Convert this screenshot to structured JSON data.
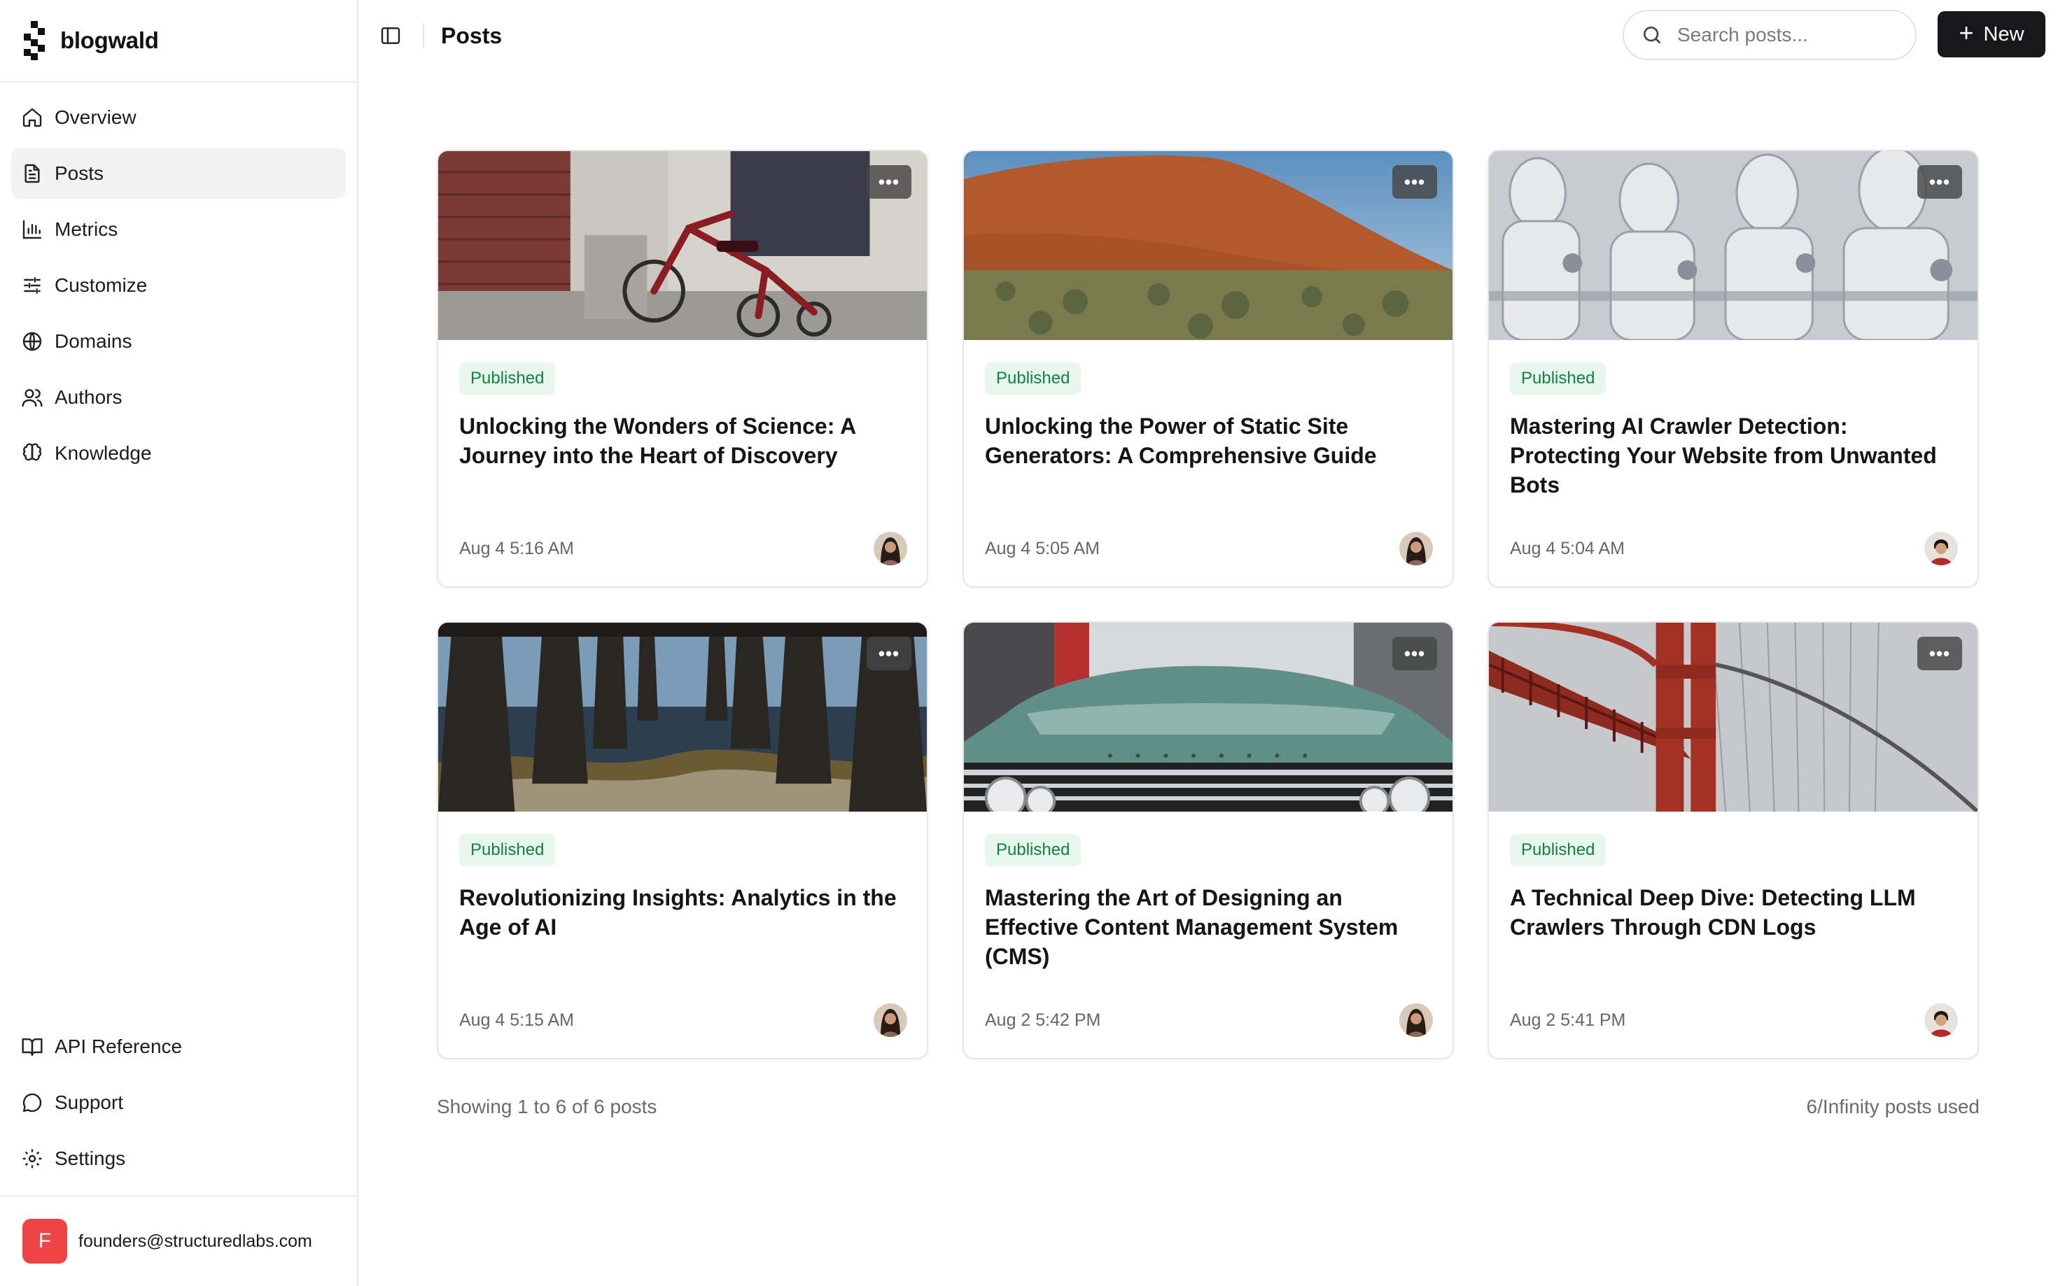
{
  "brand": {
    "name": "blogwald"
  },
  "nav": {
    "items": [
      {
        "label": "Overview",
        "icon": "home-icon"
      },
      {
        "label": "Posts",
        "icon": "document-icon"
      },
      {
        "label": "Metrics",
        "icon": "bar-chart-icon"
      },
      {
        "label": "Customize",
        "icon": "sliders-icon"
      },
      {
        "label": "Domains",
        "icon": "globe-icon"
      },
      {
        "label": "Authors",
        "icon": "users-icon"
      },
      {
        "label": "Knowledge",
        "icon": "brain-icon"
      }
    ],
    "bottom": [
      {
        "label": "API Reference",
        "icon": "book-icon"
      },
      {
        "label": "Support",
        "icon": "chat-bubble-icon"
      },
      {
        "label": "Settings",
        "icon": "gear-icon"
      }
    ]
  },
  "account": {
    "initial": "F",
    "email": "founders@structuredlabs.com"
  },
  "header": {
    "title": "Posts",
    "search_placeholder": "Search posts...",
    "new_label": "New"
  },
  "posts": [
    {
      "status": "Published",
      "title": "Unlocking the Wonders of Science: A Journey into the Heart of Discovery",
      "date": "Aug 4 5:16 AM",
      "image": "tricycle",
      "avatar": "woman"
    },
    {
      "status": "Published",
      "title": "Unlocking the Power of Static Site Generators: A Comprehensive Guide",
      "date": "Aug 4 5:05 AM",
      "image": "desert-rock",
      "avatar": "woman"
    },
    {
      "status": "Published",
      "title": "Mastering AI Crawler Detection: Protecting Your Website from Unwanted Bots",
      "date": "Aug 4 5:04 AM",
      "image": "robots",
      "avatar": "man"
    },
    {
      "status": "Published",
      "title": "Revolutionizing Insights: Analytics in the Age of AI",
      "date": "Aug 4 5:15 AM",
      "image": "pier",
      "avatar": "woman"
    },
    {
      "status": "Published",
      "title": "Mastering the Art of Designing an Effective Content Management System (CMS)",
      "date": "Aug 2 5:42 PM",
      "image": "car",
      "avatar": "woman"
    },
    {
      "status": "Published",
      "title": "A Technical Deep Dive: Detecting LLM Crawlers Through CDN Logs",
      "date": "Aug 2 5:41 PM",
      "image": "bridge",
      "avatar": "man"
    }
  ],
  "footer": {
    "showing": "Showing 1 to 6 of 6 posts",
    "usage": "6/Infinity posts used"
  },
  "colors": {
    "accent": "#18181b",
    "published_bg": "#e8f7ee",
    "published_text": "#15803d",
    "account_avatar": "#ef4444"
  }
}
